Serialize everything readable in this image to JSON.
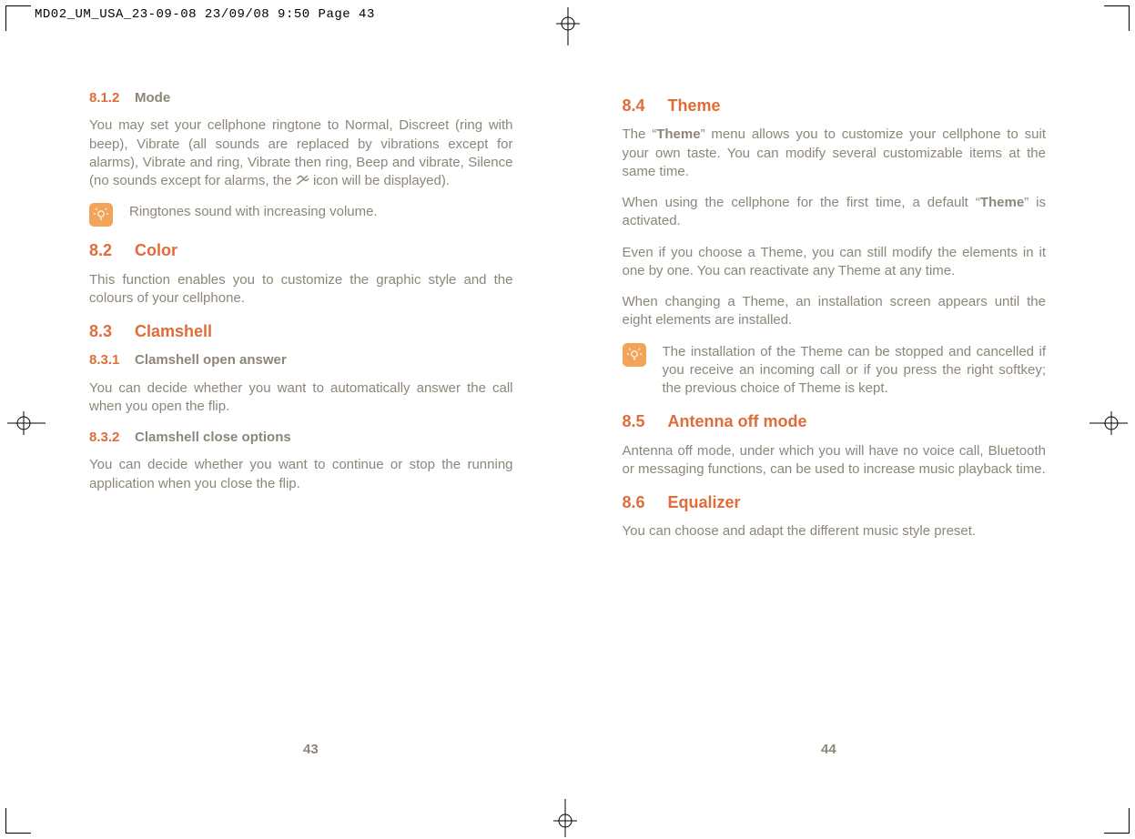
{
  "print_header": "MD02_UM_USA_23-09-08  23/09/08  9:50  Page 43",
  "page_numbers": {
    "left": "43",
    "right": "44"
  },
  "left": {
    "s812": {
      "num": "8.1.2",
      "title": "Mode",
      "body_a": "You may set your cellphone ringtone to Normal, Discreet (ring with beep), Vibrate (all sounds are replaced by vibrations except for alarms), Vibrate and ring, Vibrate then ring, Beep and vibrate, Silence (no sounds except for alarms, the ",
      "body_b": " icon will be displayed)."
    },
    "tip1": "Ringtones sound with increasing volume.",
    "s82": {
      "num": "8.2",
      "title": "Color",
      "body": "This function enables you to customize the graphic style and the colours of your cellphone."
    },
    "s83": {
      "num": "8.3",
      "title": "Clamshell"
    },
    "s831": {
      "num": "8.3.1",
      "title": "Clamshell open answer",
      "body": "You can decide whether you want to automatically answer the call when you open the flip."
    },
    "s832": {
      "num": "8.3.2",
      "title": "Clamshell close options",
      "body": "You can decide whether you want to continue or stop the running application when you close the flip."
    }
  },
  "right": {
    "s84": {
      "num": "8.4",
      "title": "Theme",
      "p1a": "The “",
      "p1b": "Theme",
      "p1c": "” menu allows you to customize your cellphone to suit your own taste. You can modify several customizable items at the same time.",
      "p2a": "When using the cellphone for the first time, a default “",
      "p2b": "Theme",
      "p2c": "” is activated.",
      "p3": "Even if you choose a Theme, you can still modify the elements in it one by one. You can reactivate any Theme at any time.",
      "p4": "When changing a Theme, an installation screen appears until the eight elements are installed."
    },
    "tip2": "The installation of the Theme can be stopped and cancelled if you receive an incoming call or if you press the right softkey; the previous choice of Theme is kept.",
    "s85": {
      "num": "8.5",
      "title": "Antenna off mode",
      "body": "Antenna off mode, under which you will have no voice call, Bluetooth or messaging functions, can be used to increase music playback time."
    },
    "s86": {
      "num": "8.6",
      "title": "Equalizer",
      "body": "You can choose and adapt the different music style preset."
    }
  }
}
